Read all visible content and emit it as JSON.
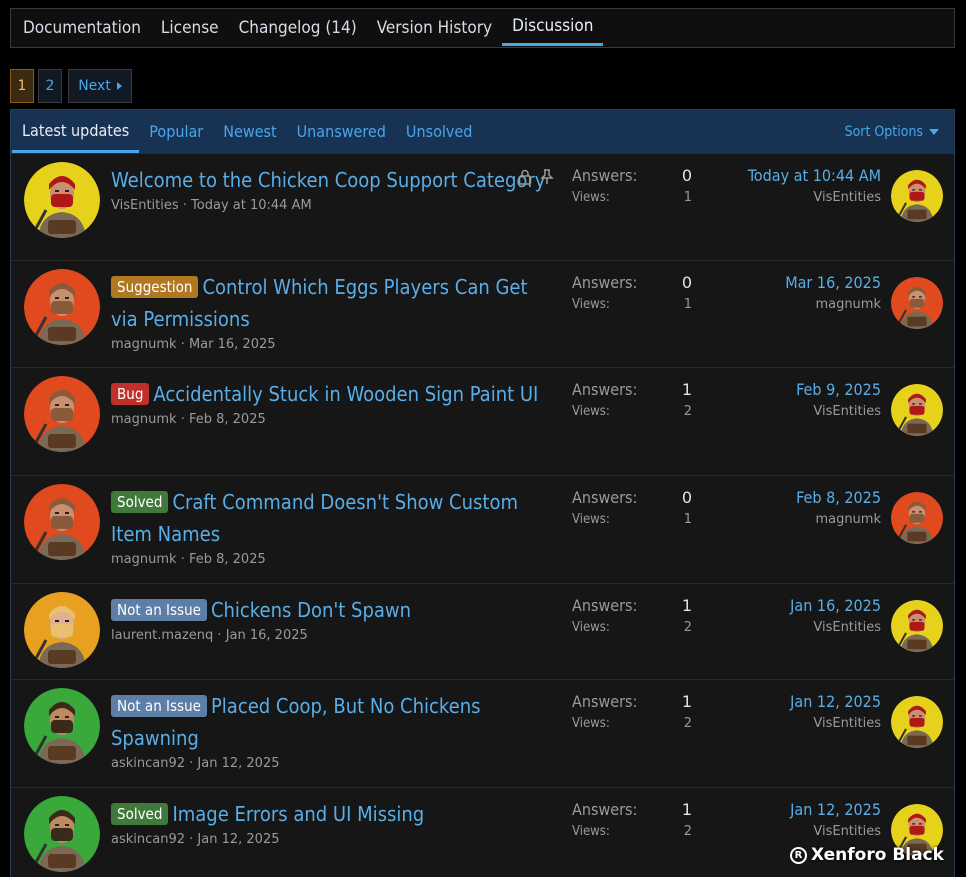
{
  "tabs": [
    "Documentation",
    "License",
    "Changelog (14)",
    "Version History",
    "Discussion"
  ],
  "pager": {
    "current": "1",
    "other": "2",
    "next": "Next"
  },
  "filters": [
    "Latest updates",
    "Popular",
    "Newest",
    "Unanswered",
    "Unsolved"
  ],
  "sort_label": "Sort Options",
  "answers_label": "Answers:",
  "views_label": "Views:",
  "threads": [
    {
      "prefix": "",
      "title": "Welcome to the Chicken Coop Support Category",
      "author": "VisEntities",
      "date": "Today at 10:44 AM",
      "answers": "0",
      "views": "1",
      "last_date": "Today at 10:44 AM",
      "last_user": "VisEntities"
    },
    {
      "prefix": "Suggestion",
      "title": "Control Which Eggs Players Can Get via Permissions",
      "author": "magnumk",
      "date": "Mar 16, 2025",
      "answers": "0",
      "views": "1",
      "last_date": "Mar 16, 2025",
      "last_user": "magnumk"
    },
    {
      "prefix": "Bug",
      "title": "Accidentally Stuck in Wooden Sign Paint UI",
      "author": "magnumk",
      "date": "Feb 8, 2025",
      "answers": "1",
      "views": "2",
      "last_date": "Feb 9, 2025",
      "last_user": "VisEntities"
    },
    {
      "prefix": "Solved",
      "title": "Craft Command Doesn't Show Custom Item Names",
      "author": "magnumk",
      "date": "Feb 8, 2025",
      "answers": "0",
      "views": "1",
      "last_date": "Feb 8, 2025",
      "last_user": "magnumk"
    },
    {
      "prefix": "Not an Issue",
      "title": "Chickens Don't Spawn",
      "author": "laurent.mazenq",
      "date": "Jan 16, 2025",
      "answers": "1",
      "views": "2",
      "last_date": "Jan 16, 2025",
      "last_user": "VisEntities"
    },
    {
      "prefix": "Not an Issue",
      "title": "Placed Coop, But No Chickens Spawning",
      "author": "askincan92",
      "date": "Jan 12, 2025",
      "answers": "1",
      "views": "2",
      "last_date": "Jan 12, 2025",
      "last_user": "VisEntities"
    },
    {
      "prefix": "Solved",
      "title": "Image Errors and UI Missing",
      "author": "askincan92",
      "date": "Jan 12, 2025",
      "answers": "1",
      "views": "2",
      "last_date": "Jan 12, 2025",
      "last_user": "VisEntities"
    }
  ],
  "watermark": "Xenforo Black",
  "colors": {
    "accent": "#47a7eb",
    "link": "#58aee8",
    "filterbar": "#183254",
    "suggestion": "#b07820",
    "bug": "#c0302a",
    "solved": "#3f7a3a",
    "not_an_issue": "#5d7ea6"
  }
}
